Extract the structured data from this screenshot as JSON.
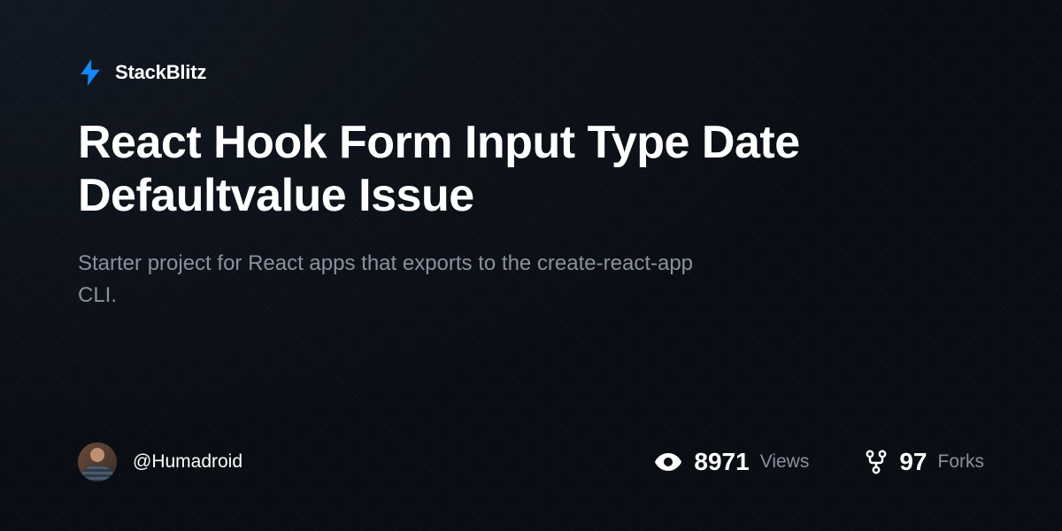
{
  "brand": {
    "name": "StackBlitz",
    "accent_color": "#1389fd"
  },
  "project": {
    "title": "React Hook Form Input Type Date Defaultvalue Issue",
    "description": "Starter project for React apps that exports to the create-react-app CLI."
  },
  "author": {
    "handle": "@Humadroid"
  },
  "stats": {
    "views": {
      "value": "8971",
      "label": "Views"
    },
    "forks": {
      "value": "97",
      "label": "Forks"
    }
  }
}
